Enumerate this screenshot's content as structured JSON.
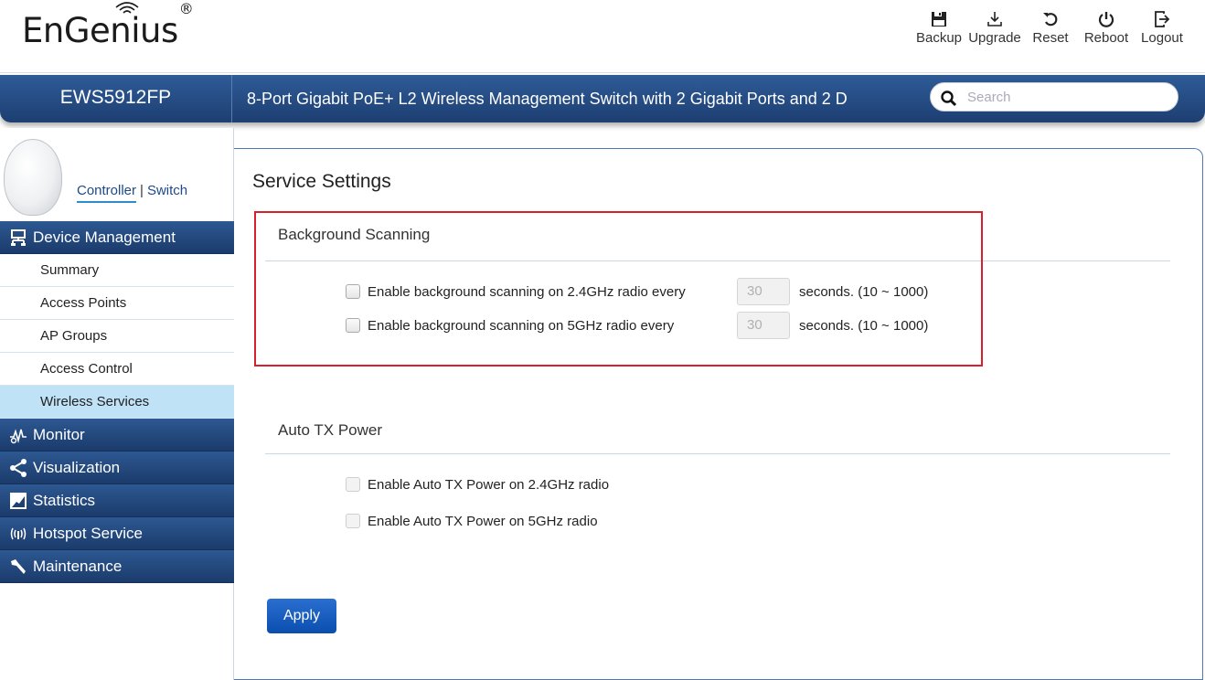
{
  "header": {
    "logo_text": "EnGenius",
    "logo_mark": "®",
    "toolbar": [
      {
        "label": "Backup",
        "icon": "floppy-disk-icon"
      },
      {
        "label": "Upgrade",
        "icon": "download-tray-icon"
      },
      {
        "label": "Reset",
        "icon": "undo-arrow-icon"
      },
      {
        "label": "Reboot",
        "icon": "power-icon"
      },
      {
        "label": "Logout",
        "icon": "logout-icon"
      }
    ]
  },
  "titlebar": {
    "model": "EWS5912FP",
    "description": "8-Port Gigabit PoE+ L2 Wireless Management Switch with 2 Gigabit Ports and 2 D",
    "search_placeholder": "Search"
  },
  "sidebar": {
    "controller_label": "Controller",
    "separator": "|",
    "switch_label": "Switch",
    "sections": [
      {
        "label": "Device Management",
        "icon": "device-management-icon"
      },
      {
        "label": "Monitor",
        "icon": "monitor-icon"
      },
      {
        "label": "Visualization",
        "icon": "share-icon"
      },
      {
        "label": "Statistics",
        "icon": "statistics-icon"
      },
      {
        "label": "Hotspot Service",
        "icon": "hotspot-icon"
      },
      {
        "label": "Maintenance",
        "icon": "wrench-icon"
      }
    ],
    "device_management_items": [
      {
        "label": "Summary"
      },
      {
        "label": "Access Points"
      },
      {
        "label": "AP Groups"
      },
      {
        "label": "Access Control"
      },
      {
        "label": "Wireless Services",
        "active": true
      }
    ]
  },
  "main": {
    "page_title": "Service Settings",
    "background_scanning": {
      "title": "Background Scanning",
      "rows": [
        {
          "label": "Enable background scanning on 2.4GHz radio every",
          "value": "30",
          "unit": "seconds. (10 ~ 1000)"
        },
        {
          "label": "Enable background scanning on 5GHz radio every",
          "value": "30",
          "unit": "seconds. (10 ~ 1000)"
        }
      ]
    },
    "auto_tx_power": {
      "title": "Auto TX Power",
      "rows": [
        {
          "label": "Enable Auto TX Power on 2.4GHz radio"
        },
        {
          "label": "Enable Auto TX Power on 5GHz radio"
        }
      ]
    },
    "apply_label": "Apply"
  },
  "colors": {
    "nav_blue": "#1d3f72",
    "active_item": "#bfe2f7",
    "highlight_red": "#d8202c",
    "apply_blue": "#0a4fae"
  }
}
